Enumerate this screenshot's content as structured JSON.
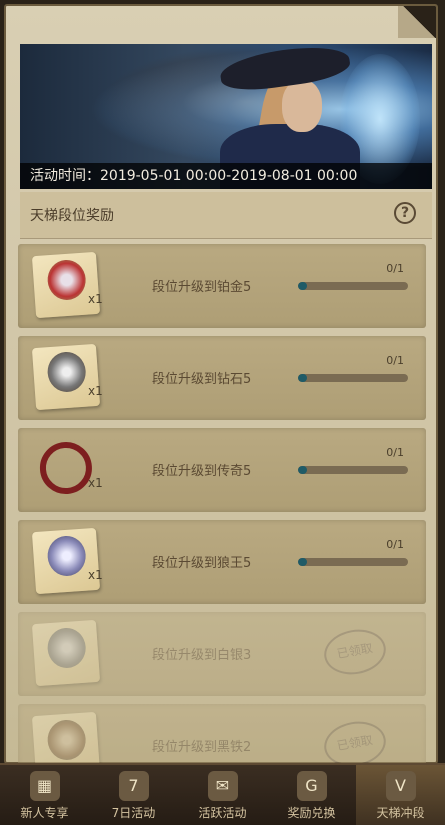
{
  "event": {
    "time_text": "活动时间：2019-05-01 00:00-2019-08-01 00:00"
  },
  "section": {
    "title": "天梯段位奖励"
  },
  "tasks": [
    {
      "label": "段位升级到铂金5",
      "progress": "0/1",
      "progress_fraction": 0.0,
      "reward_qty": "x1",
      "state": "active"
    },
    {
      "label": "段位升级到钻石5",
      "progress": "0/1",
      "progress_fraction": 0.0,
      "reward_qty": "x1",
      "state": "active"
    },
    {
      "label": "段位升级到传奇5",
      "progress": "0/1",
      "progress_fraction": 0.0,
      "reward_qty": "x1",
      "state": "active"
    },
    {
      "label": "段位升级到狼王5",
      "progress": "0/1",
      "progress_fraction": 0.0,
      "reward_qty": "x1",
      "state": "active"
    },
    {
      "label": "段位升级到白银3",
      "stamp": "已领取",
      "state": "claimed"
    },
    {
      "label": "段位升级到黑铁2",
      "stamp": "已领取",
      "state": "claimed"
    }
  ],
  "nav": [
    {
      "label": "新人专享",
      "icon": "calendar-icon"
    },
    {
      "label": "7日活动",
      "icon": "seven-day-icon"
    },
    {
      "label": "活跃活动",
      "icon": "ticket-icon"
    },
    {
      "label": "奖励兑换",
      "icon": "exchange-icon"
    },
    {
      "label": "天梯冲段",
      "icon": "ladder-icon"
    }
  ],
  "colors": {
    "progress_fill": "#1f5b67",
    "panel": "#d9cfb3",
    "row": "#b9a981"
  }
}
